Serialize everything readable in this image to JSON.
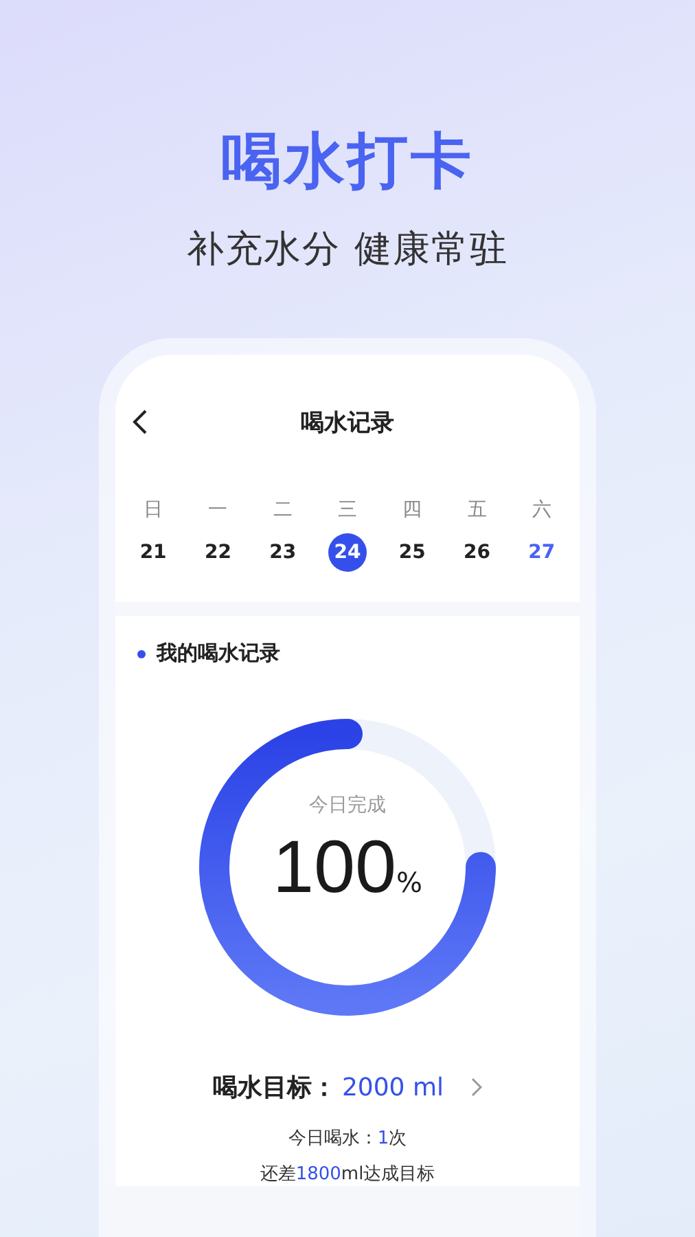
{
  "headline": "喝水打卡",
  "tagline": "补充水分 健康常驻",
  "screen": {
    "title": "喝水记录",
    "week": [
      {
        "weekday": "日",
        "date": "21",
        "selected": false,
        "accent": false
      },
      {
        "weekday": "一",
        "date": "22",
        "selected": false,
        "accent": false
      },
      {
        "weekday": "二",
        "date": "23",
        "selected": false,
        "accent": false
      },
      {
        "weekday": "三",
        "date": "24",
        "selected": true,
        "accent": false
      },
      {
        "weekday": "四",
        "date": "25",
        "selected": false,
        "accent": false
      },
      {
        "weekday": "五",
        "date": "26",
        "selected": false,
        "accent": false
      },
      {
        "weekday": "六",
        "date": "27",
        "selected": false,
        "accent": true
      }
    ],
    "record": {
      "heading": "我的喝水记录",
      "ring": {
        "caption": "今日完成",
        "value": "100",
        "unit": "%",
        "level": 0.75
      },
      "goal": {
        "label": "喝水目标：",
        "value": "2000 ml"
      },
      "stats": [
        [
          {
            "text": "今日喝水：",
            "highlight": false
          },
          {
            "text": "1",
            "highlight": true
          },
          {
            "text": "次",
            "highlight": false
          }
        ],
        [
          {
            "text": "还差",
            "highlight": false
          },
          {
            "text": "1800",
            "highlight": true
          },
          {
            "text": "ml达成目标",
            "highlight": false
          }
        ]
      ]
    }
  }
}
